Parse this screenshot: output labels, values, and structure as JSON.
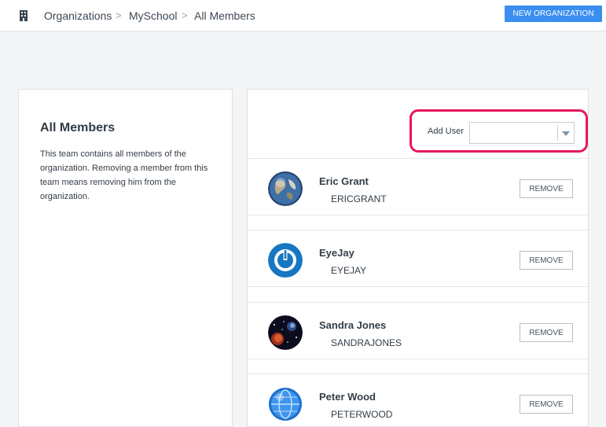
{
  "breadcrumb": {
    "icon": "building-icon",
    "items": [
      "Organizations",
      "MySchool",
      "All Members"
    ],
    "separator": ">"
  },
  "header": {
    "new_org_label": "NEW ORGANIZATION"
  },
  "team": {
    "title": "All Members",
    "description": "This team contains all members of the organization. Removing a member from this team means removing him from the organization."
  },
  "add_user": {
    "label": "Add User",
    "value": ""
  },
  "members": [
    {
      "name": "Eric Grant",
      "username": "ERICGRANT",
      "avatar": "earth-avatar",
      "remove_label": "REMOVE"
    },
    {
      "name": "EyeJay",
      "username": "EYEJAY",
      "avatar": "power-avatar",
      "remove_label": "REMOVE"
    },
    {
      "name": "Sandra Jones",
      "username": "SANDRAJONES",
      "avatar": "space-avatar",
      "remove_label": "REMOVE"
    },
    {
      "name": "Peter Wood",
      "username": "PETERWOOD",
      "avatar": "globe-avatar",
      "remove_label": "REMOVE"
    }
  ],
  "colors": {
    "accent": "#3b8ef0",
    "highlight": "#e8175d"
  }
}
